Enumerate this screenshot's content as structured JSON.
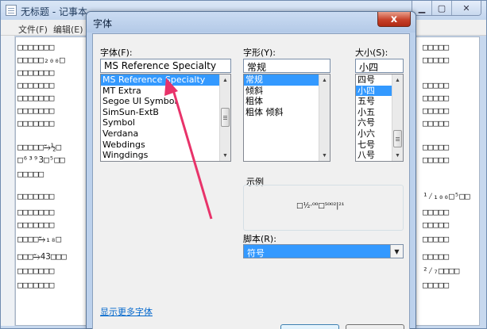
{
  "notepad": {
    "title": "无标题 - 记事本",
    "menu": [
      "文件(F)",
      "编辑(E)"
    ],
    "lines": [
      {
        "left": "□□□□□□□",
        "right": "□□□□□"
      },
      {
        "left": "□□□□□₂₀₀□",
        "right": "□□□□□"
      },
      {
        "left": "□□□□□□□",
        "right": ""
      },
      {
        "left": "□□□□□□□",
        "right": "□□□□□"
      },
      {
        "left": "□□□□□□□",
        "right": "□□□□□"
      },
      {
        "left": "□□□□□□□",
        "right": "□□□□□"
      },
      {
        "left": "□□□□□□□",
        "right": "□□□□□"
      },
      {
        "left": "□□□□□⥲½□",
        "right": "□□□□□"
      },
      {
        "left": "□⁶³⁹3□⁵□□",
        "right": "□□□□□"
      },
      {
        "left": "□□□□□",
        "right": ""
      },
      {
        "left": "□□□□□□□",
        "right": "¹⁄₁₀₀□⁵□□"
      },
      {
        "left": "□□□□□□□",
        "right": "□□□□□"
      },
      {
        "left": "□□□□□□□",
        "right": "□□□□□"
      },
      {
        "left": "□□□□⥲₁₈□",
        "right": "□□□□□"
      },
      {
        "left": "□□□⥲43□□□",
        "right": "□□□□□"
      },
      {
        "left": "□□□□□□□",
        "right": "²⁄₇□□□□"
      },
      {
        "left": "□□□□□□□",
        "right": "□□□□□"
      }
    ]
  },
  "dialog": {
    "title": "字体",
    "close_label": "x",
    "font_label": "字体(F):",
    "font_value": "MS Reference Specialty",
    "fonts": [
      "MS Reference Specialty",
      "MT Extra",
      "Segoe UI Symbol",
      "SimSun-ExtB",
      "Symbol",
      "Verdana",
      "Webdings",
      "Wingdings"
    ],
    "style_label": "字形(Y):",
    "style_value": "常规",
    "styles": [
      "常规",
      "倾斜",
      "粗体",
      "粗体 倾斜"
    ],
    "size_label": "大小(S):",
    "size_value": "小四",
    "sizes": [
      "四号",
      "小四",
      "五号",
      "小五",
      "六号",
      "小六",
      "七号",
      "八号"
    ],
    "sample_label": "示例",
    "sample_text": "□½·⁰⁰□⁵⁰⁰²|²¹",
    "script_label": "脚本(R):",
    "script_value": "符号",
    "more_fonts_link": "显示更多字体"
  },
  "colors": {
    "selection": "#3399ff",
    "arrow": "#e8336a",
    "link": "#0066cc"
  }
}
